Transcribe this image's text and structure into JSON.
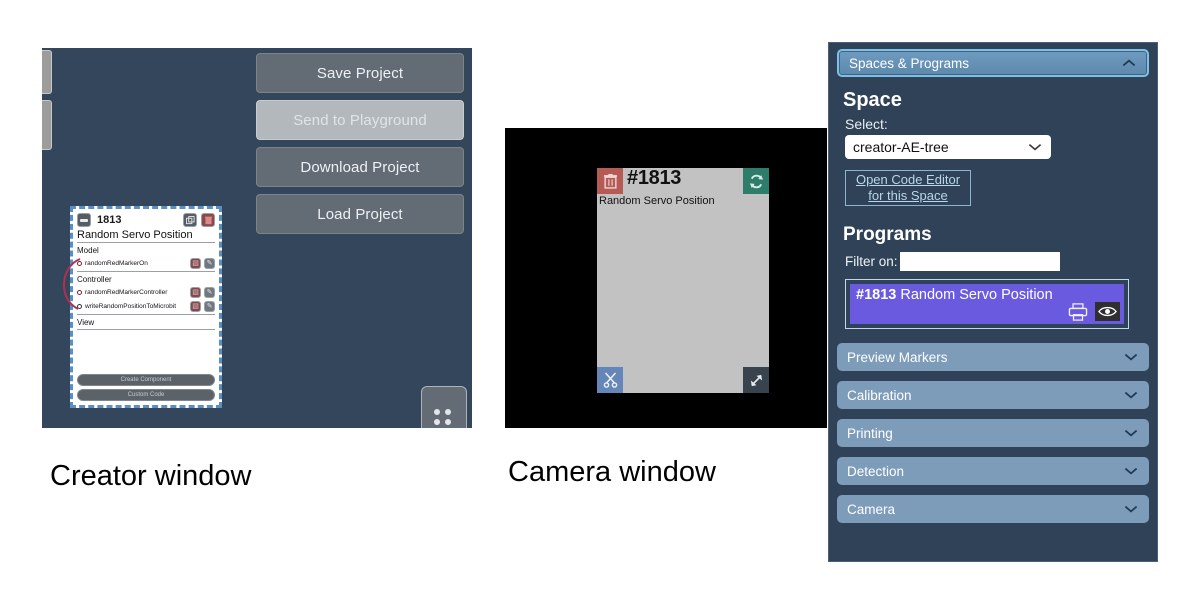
{
  "captions": {
    "creator": "Creator window",
    "camera": "Camera window"
  },
  "creator_window": {
    "project_buttons": [
      {
        "label": "Save Project",
        "state": "enabled"
      },
      {
        "label": "Send to Playground",
        "state": "disabled"
      },
      {
        "label": "Download Project",
        "state": "enabled"
      },
      {
        "label": "Load Project",
        "state": "enabled"
      }
    ],
    "node_card": {
      "id": "1813",
      "title": "Random Servo Position",
      "minimize_icon": "minimize-icon",
      "copy_icon": "copy-icon",
      "delete_icon": "trash-icon",
      "sections": [
        {
          "name": "Model",
          "items": [
            {
              "label": "randomRedMarkerOn",
              "bullet": "red"
            }
          ]
        },
        {
          "name": "Controller",
          "items": [
            {
              "label": "randomRedMarkerController",
              "bullet": "red"
            },
            {
              "label": "writeRandomPositionToMicrobit",
              "bullet": "dark"
            }
          ]
        },
        {
          "name": "View",
          "items": []
        }
      ],
      "footer_buttons": [
        "Create Component",
        "Custom Code"
      ]
    },
    "dots_widget_icon": "grid-dots-icon"
  },
  "camera_window": {
    "card": {
      "id": "#1813",
      "subtitle": "Random Servo Position",
      "corner_icons": {
        "top_left": "trash-icon",
        "top_right": "refresh-icon",
        "bottom_left": "scissors-icon",
        "bottom_right": "resize-icon"
      }
    }
  },
  "right_panel": {
    "main_section": {
      "title": "Spaces & Programs",
      "expanded": true,
      "chevron_icon": "chevron-up-icon"
    },
    "space": {
      "heading": "Space",
      "select_label": "Select:",
      "select_value": "creator-AE-tree",
      "select_chevron_icon": "chevron-down-icon",
      "code_editor_link_line1": "Open Code Editor",
      "code_editor_link_line2": "for this Space"
    },
    "programs": {
      "heading": "Programs",
      "filter_label": "Filter on:",
      "filter_value": "",
      "filter_placeholder": "",
      "items": [
        {
          "id": "#1813",
          "name": "Random Servo Position",
          "print_icon": "printer-icon",
          "view_icon": "eye-icon",
          "selected": true
        }
      ]
    },
    "collapsed_sections": [
      {
        "title": "Preview Markers",
        "chevron_icon": "chevron-down-icon"
      },
      {
        "title": "Calibration",
        "chevron_icon": "chevron-down-icon"
      },
      {
        "title": "Printing",
        "chevron_icon": "chevron-down-icon"
      },
      {
        "title": "Detection",
        "chevron_icon": "chevron-down-icon"
      },
      {
        "title": "Camera",
        "chevron_icon": "chevron-down-icon"
      }
    ]
  },
  "colors": {
    "creator_bg": "#33465c",
    "panel_bg": "#2f4257",
    "accordion_bg": "#7d9cba",
    "program_selected": "#6a5ae0",
    "camera_bg": "#000000",
    "card_bg": "#c2c2c2",
    "accent_delete": "#b55b55",
    "accent_refresh": "#2e7d6b",
    "accent_scissors": "#6486b8"
  }
}
